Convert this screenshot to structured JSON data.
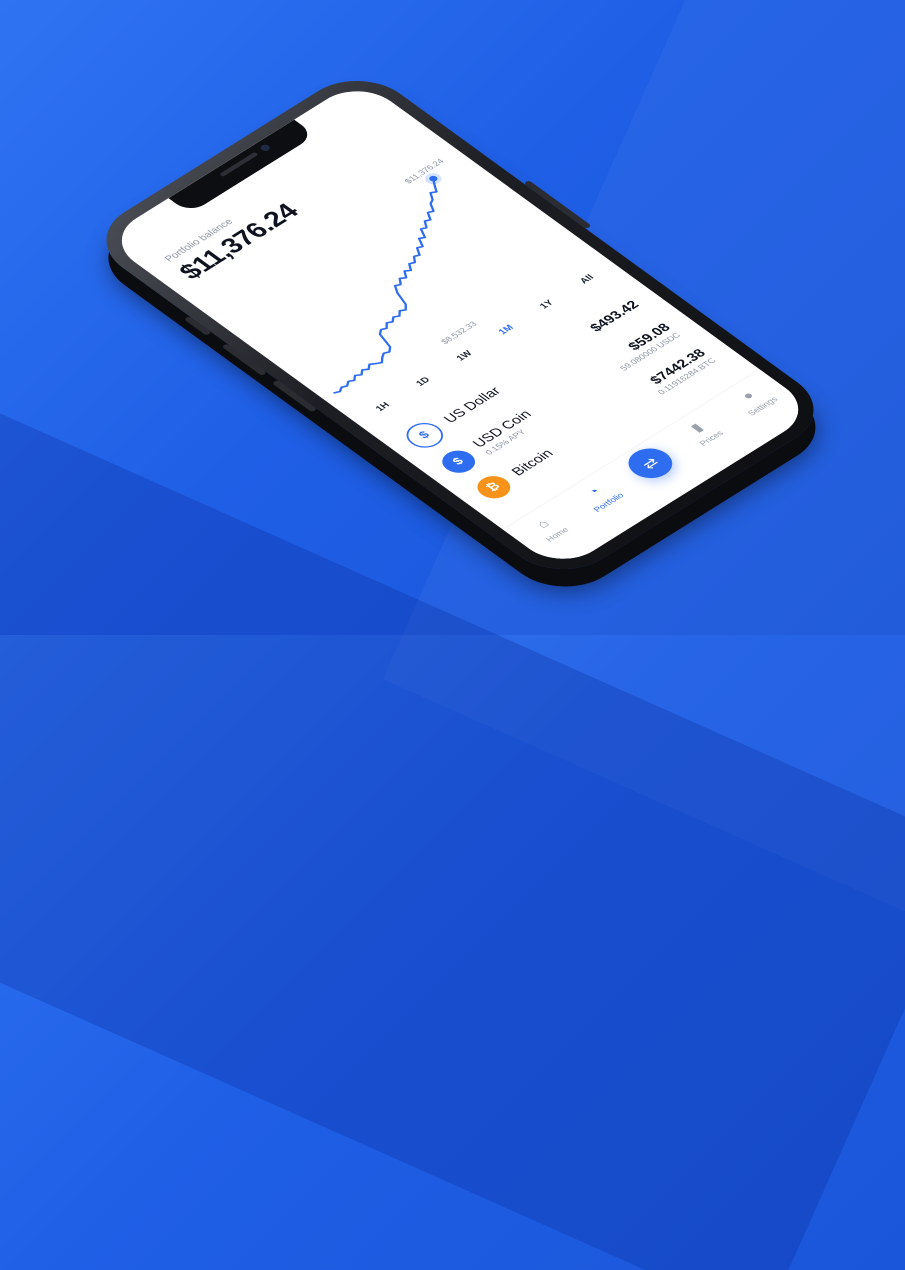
{
  "portfolio": {
    "label": "Portfolio balance",
    "balance": "$11,376.24"
  },
  "chart_data": {
    "type": "line",
    "max_label": "$11,376.24",
    "min_label": "$8,532.33",
    "color": "#2f6df0",
    "series": [
      {
        "values": [
          8600,
          8560,
          8620,
          8580,
          8650,
          8600,
          8680,
          8620,
          8700,
          8640,
          8720,
          8660,
          8610,
          8700,
          8760,
          8720,
          8800,
          9150,
          9220,
          9180,
          9280,
          9230,
          9310,
          9260,
          9350,
          9300,
          9400,
          9700,
          9860,
          9820,
          9940,
          9880,
          10020,
          9960,
          10100,
          10060,
          10180,
          10140,
          10300,
          10260,
          10450,
          10400,
          10600,
          10560,
          10700,
          10660,
          10820,
          10780,
          10950,
          11000,
          11150,
          11100,
          11250,
          11376.24
        ]
      }
    ]
  },
  "ranges": [
    "1H",
    "1D",
    "1W",
    "1M",
    "1Y",
    "All"
  ],
  "active_range": "1M",
  "assets": [
    {
      "name": "US Dollar",
      "sub": "",
      "value": "$493.42",
      "amount": "",
      "icon": "dollar-icon",
      "symbol": "$",
      "color": "#2f6df0",
      "bg": "#ffffff"
    },
    {
      "name": "USD Coin",
      "sub": "0.15% APY",
      "value": "$59.08",
      "amount": "59.080000 USDC",
      "icon": "usdc-icon",
      "symbol": "$",
      "color": "#ffffff",
      "bg": "#2f6df0"
    },
    {
      "name": "Bitcoin",
      "sub": "",
      "value": "$7442.38",
      "amount": "0.11916284 BTC",
      "icon": "bitcoin-icon",
      "symbol": "₿",
      "color": "#ffffff",
      "bg": "#f7931a"
    }
  ],
  "tabs": [
    {
      "label": "Home",
      "icon": "home-icon",
      "glyph": "⌂"
    },
    {
      "label": "Portfolio",
      "icon": "pie-chart-icon",
      "glyph": "◔"
    },
    {
      "label": "",
      "icon": "swap-icon",
      "glyph": "⇄"
    },
    {
      "label": "Prices",
      "icon": "bar-chart-icon",
      "glyph": "▮"
    },
    {
      "label": "Settings",
      "icon": "user-icon",
      "glyph": "●"
    }
  ],
  "active_tab": "Portfolio"
}
